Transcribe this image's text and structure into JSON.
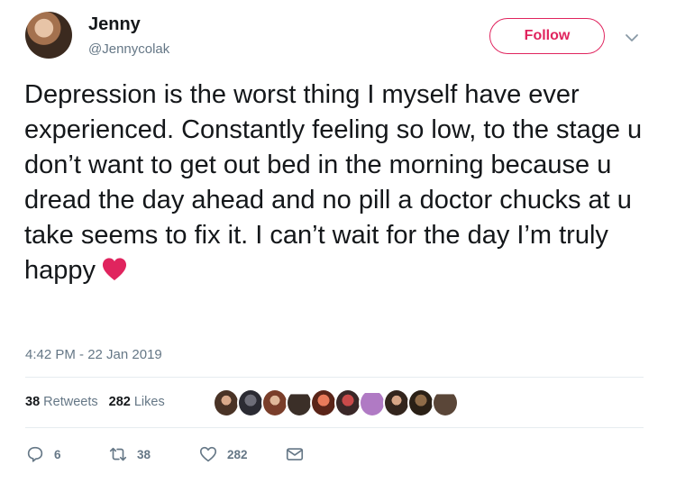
{
  "user": {
    "name": "Jenny",
    "handle": "@Jennycolak"
  },
  "follow_label": "Follow",
  "tweet": {
    "text": "Depression is the worst thing I myself have ever experienced. Constantly feeling so low, to the stage u don’t want to get out bed in the morning because u dread the day ahead and no pill a doctor chucks at u take seems to fix it. I can’t wait for the day I’m truly happy",
    "emoji": "red-heart",
    "timestamp": "4:42 PM - 22 Jan 2019"
  },
  "stats": {
    "retweets_count": "38",
    "retweets_label": "Retweets",
    "likes_count": "282",
    "likes_label": "Likes"
  },
  "actions": {
    "reply_count": "6",
    "retweet_count": "38",
    "like_count": "282"
  },
  "icons": [
    "reply-icon",
    "retweet-icon",
    "like-icon",
    "dm-icon",
    "caret-icon"
  ],
  "colors": {
    "follow_accent": "#e0245e",
    "heart": "#e0245e",
    "muted": "#657786",
    "text": "#14171a"
  }
}
